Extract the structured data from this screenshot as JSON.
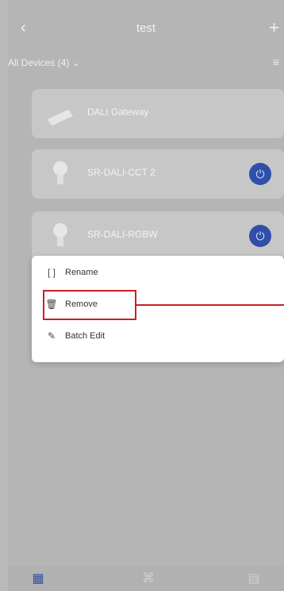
{
  "header": {
    "back_icon": "chevron-left-icon",
    "title": "test",
    "add_icon": "plus-icon"
  },
  "filter": {
    "label": "All Devices (4)",
    "chevron": "⌄",
    "right_icon": "menu-icon"
  },
  "devices": [
    {
      "name": "DALI Gateway",
      "icon": "gateway-icon",
      "has_power": false
    },
    {
      "name": "SR-DALI-CCT 2",
      "icon": "bulb-icon",
      "has_power": true
    },
    {
      "name": "SR-DALI-RGBW",
      "icon": "bulb-icon",
      "has_power": true
    }
  ],
  "menu": {
    "items": [
      {
        "label": "Rename",
        "icon": "rename-icon"
      },
      {
        "label": "Remove",
        "icon": "trash-icon"
      },
      {
        "label": "Batch Edit",
        "icon": "batch-edit-icon"
      }
    ]
  },
  "bottom_nav": {
    "tabs": [
      {
        "icon": "grid-icon",
        "active": true
      },
      {
        "icon": "scene-icon",
        "active": false
      },
      {
        "icon": "group-icon",
        "active": false
      }
    ]
  },
  "colors": {
    "accent": "#2f4fa8",
    "highlight": "#c92020",
    "overlay": "#b5b5b5"
  }
}
